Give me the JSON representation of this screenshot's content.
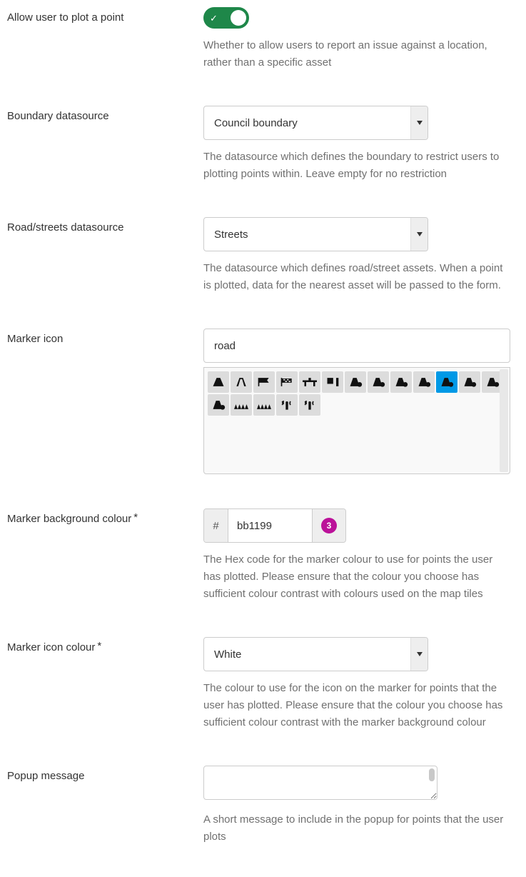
{
  "allow_plot": {
    "label": "Allow user to plot a point",
    "toggle_on": true,
    "help": "Whether to allow users to report an issue against a location, rather than a specific asset"
  },
  "boundary_ds": {
    "label": "Boundary datasource",
    "value": "Council boundary",
    "help": "The datasource which defines the boundary to restrict users to plotting points within. Leave empty for no restriction"
  },
  "roads_ds": {
    "label": "Road/streets datasource",
    "value": "Streets",
    "help": "The datasource which defines road/street assets. When a point is plotted, data for the nearest asset will be passed to the form."
  },
  "marker_icon": {
    "label": "Marker icon",
    "search_value": "road",
    "icons": [
      {
        "name": "road-solid-icon",
        "selected": false
      },
      {
        "name": "road-outline-icon",
        "selected": false
      },
      {
        "name": "flag-a-icon",
        "selected": false
      },
      {
        "name": "flag-b-icon",
        "selected": false
      },
      {
        "name": "road-bridge-icon",
        "selected": false
      },
      {
        "name": "road-sign-icon",
        "selected": false
      },
      {
        "name": "road-variant-a-icon",
        "selected": false
      },
      {
        "name": "road-variant-b-icon",
        "selected": false
      },
      {
        "name": "road-variant-c-icon",
        "selected": false
      },
      {
        "name": "road-variant-d-icon",
        "selected": false
      },
      {
        "name": "road-variant-selected-icon",
        "selected": true
      },
      {
        "name": "road-variant-e-icon",
        "selected": false
      },
      {
        "name": "road-variant-f-icon",
        "selected": false
      },
      {
        "name": "road-lock-icon",
        "selected": false
      },
      {
        "name": "road-teeth-a-icon",
        "selected": false
      },
      {
        "name": "road-teeth-b-icon",
        "selected": false
      },
      {
        "name": "road-antenna-a-icon",
        "selected": false
      },
      {
        "name": "road-antenna-b-icon",
        "selected": false
      }
    ]
  },
  "marker_bg": {
    "label": "Marker background colour",
    "hash": "#",
    "value": "bb1199",
    "swatch_text": "3",
    "swatch_color": "#bb1199",
    "help": "The Hex code for the marker colour to use for points the user has plotted. Please ensure that the colour you choose has sufficient colour contrast with colours used on the map tiles"
  },
  "marker_icon_colour": {
    "label": "Marker icon colour",
    "value": "White",
    "help": "The colour to use for the icon on the marker for points that the user has plotted. Please ensure that the colour you choose has sufficient colour contrast with the marker background colour"
  },
  "popup_msg": {
    "label": "Popup message",
    "value": "",
    "help": "A short message to include in the popup for points that the user plots"
  }
}
